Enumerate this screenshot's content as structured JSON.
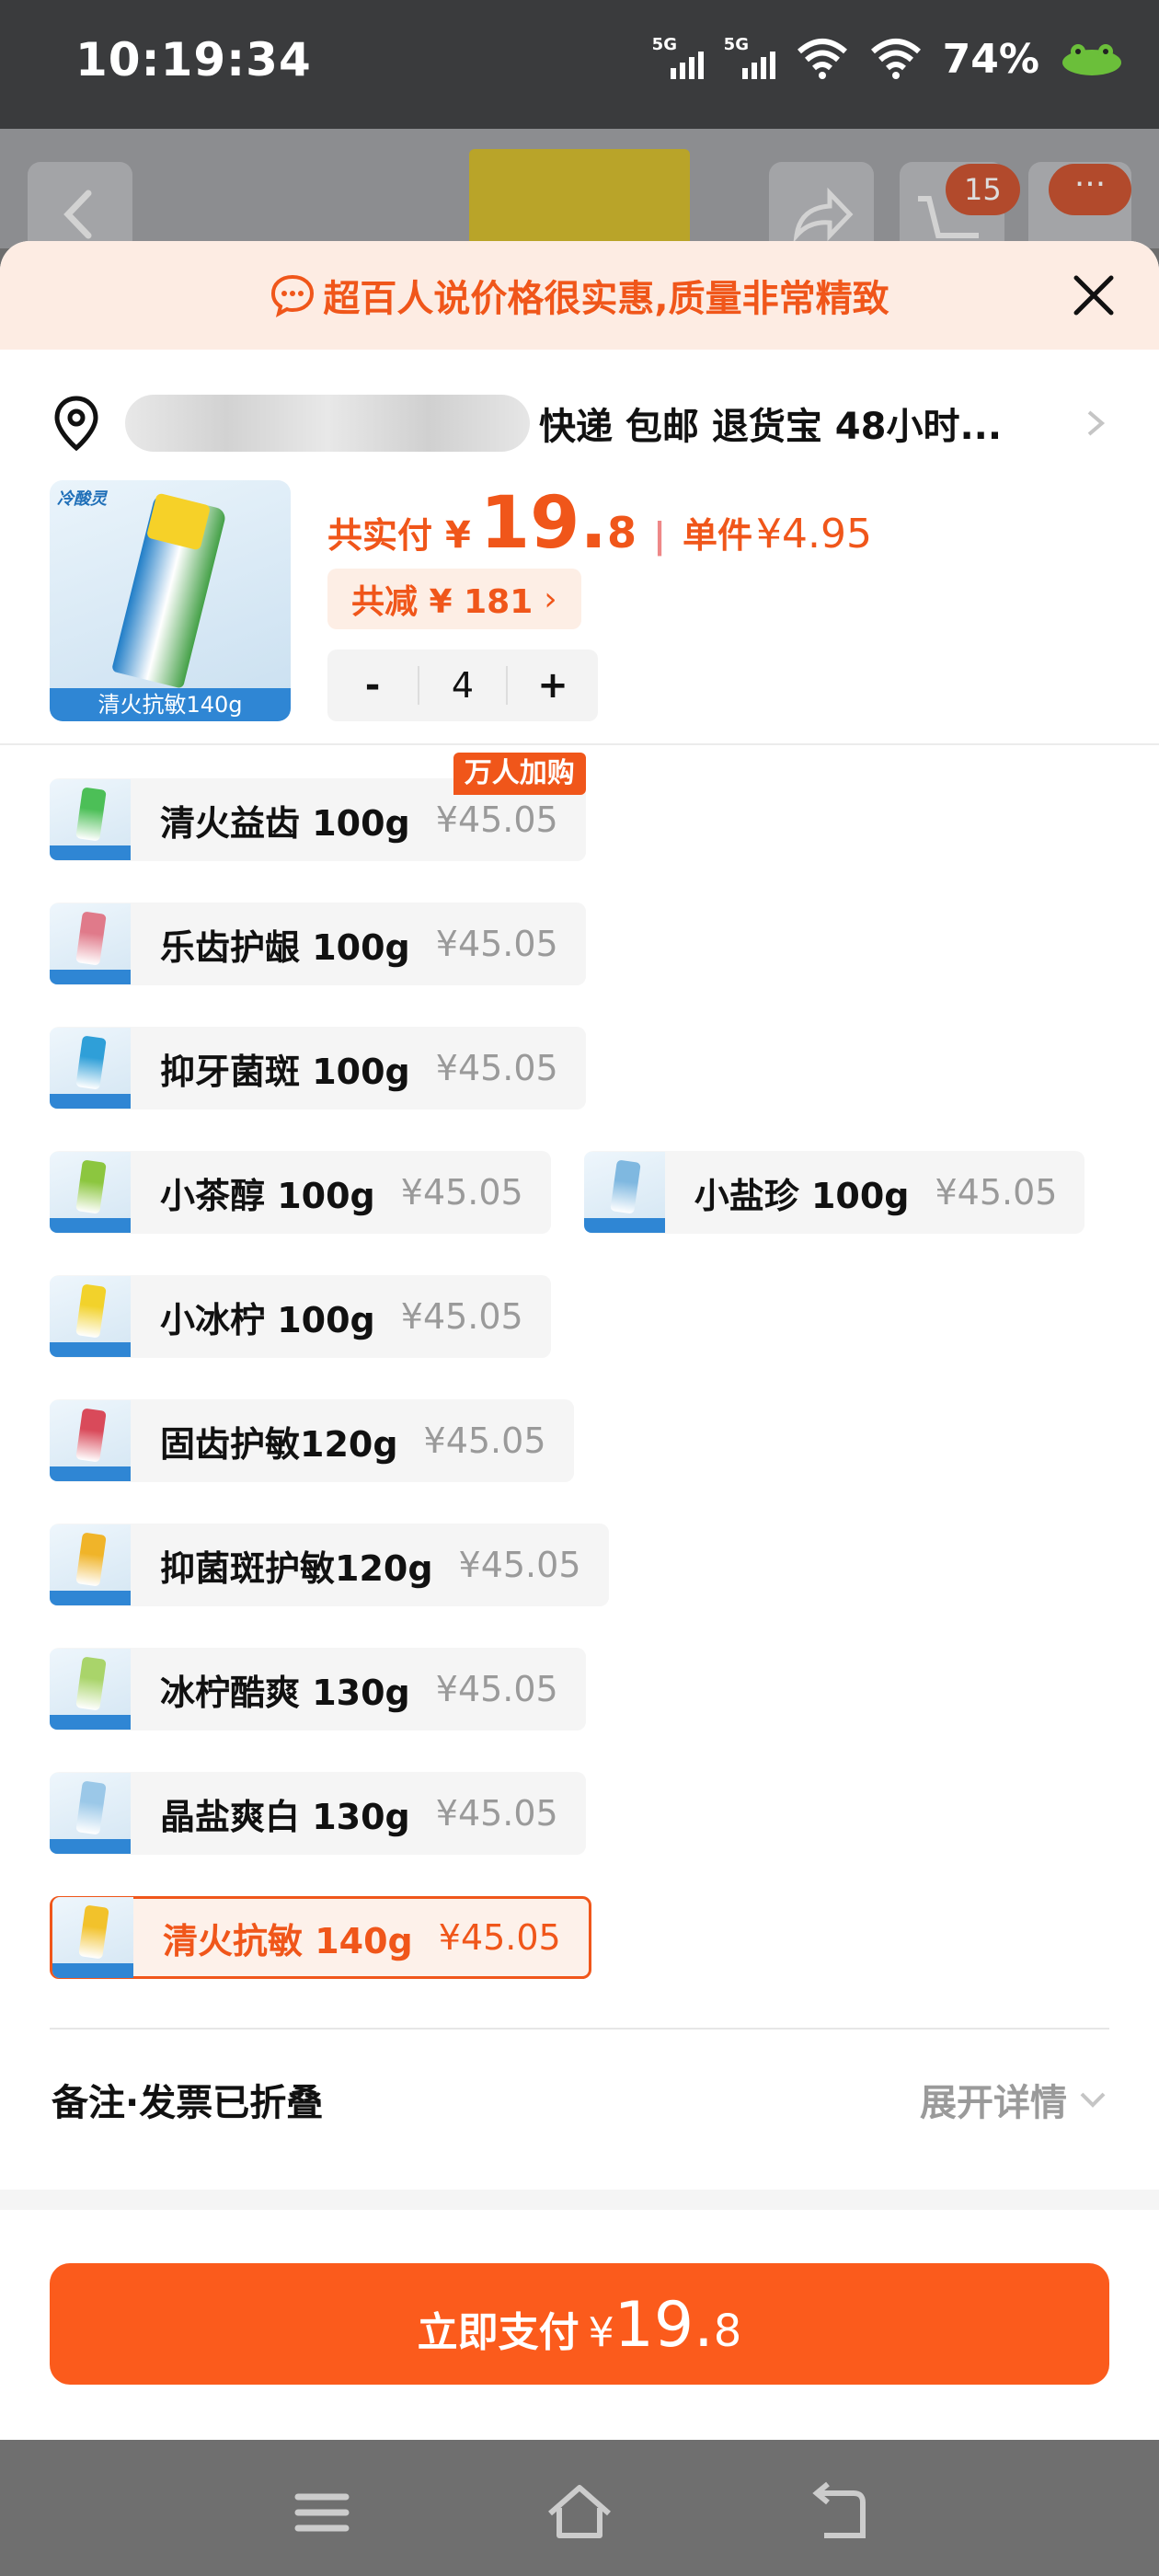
{
  "status_bar": {
    "time": "10:19:34",
    "sim1": "5G",
    "sim2": "5G",
    "battery": "74%"
  },
  "background": {
    "cart_count": "15",
    "more": "···"
  },
  "promo": {
    "text": "超百人说价格很实惠,质量非常精致"
  },
  "address": {
    "shipping_info": "快递 包邮 退货宝 48小时..."
  },
  "product": {
    "brand": "冷酸灵",
    "image_label": "清火抗敏140g",
    "total_label": "共实付",
    "currency": "¥",
    "total_int": "19.",
    "total_dec": "8",
    "separator": "|",
    "unit_label": "单件",
    "unit_price": "¥4.95",
    "discount": "共减 ¥ 181",
    "discount_chevron": "›",
    "quantity": "4",
    "minus": "-",
    "plus": "+"
  },
  "variants": [
    {
      "name": "清火益齿 100g",
      "price": "¥45.05",
      "badge": "万人加购",
      "tube": "#4cbf57"
    },
    {
      "name": "乐齿护龈 100g",
      "price": "¥45.05",
      "tube": "#e07a8a"
    },
    {
      "name": "抑牙菌斑 100g",
      "price": "¥45.05",
      "tube": "#2f9fd8"
    },
    {
      "name": "小茶醇 100g",
      "price": "¥45.05",
      "tube": "#8cc63f"
    },
    {
      "name": "小盐珍 100g",
      "price": "¥45.05",
      "tube": "#7fb8e0"
    },
    {
      "name": "小冰柠 100g",
      "price": "¥45.05",
      "tube": "#f2d22b"
    },
    {
      "name": "固齿护敏120g",
      "price": "¥45.05",
      "tube": "#d94a5a"
    },
    {
      "name": "抑菌斑护敏120g",
      "price": "¥45.05",
      "tube": "#f0b429"
    },
    {
      "name": "冰柠酷爽 130g",
      "price": "¥45.05",
      "tube": "#a9d46a"
    },
    {
      "name": "晶盐爽白 130g",
      "price": "¥45.05",
      "tube": "#9bc8e8"
    },
    {
      "name": "清火抗敏 140g",
      "price": "¥45.05",
      "selected": true,
      "tube": "#f2c22b"
    }
  ],
  "notes": {
    "label": "备注·发票已折叠",
    "expand": "展开详情"
  },
  "pay": {
    "label": "立即支付",
    "currency": "¥",
    "amount_int": "19.",
    "amount_dec": "8"
  },
  "colors": {
    "accent": "#f0561a",
    "pay_button": "#fb5b1c",
    "promo_bg": "#fdece3"
  }
}
